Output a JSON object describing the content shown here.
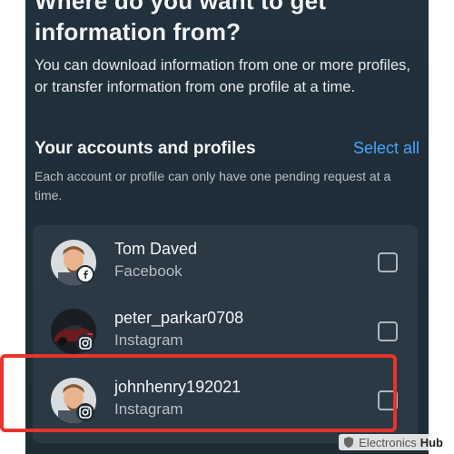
{
  "screen": {
    "heading_line1": "Where do you want to get",
    "heading_line2": "information from?",
    "description": "You can download information from one or more profiles, or transfer information from one profile at a time."
  },
  "section": {
    "title": "Your accounts and profiles",
    "select_all_label": "Select all",
    "subtitle": "Each account or profile can only have one pending request at a time."
  },
  "accounts": [
    {
      "name": "Tom Daved",
      "platform": "Facebook",
      "badge_icon": "facebook-icon",
      "checked": false
    },
    {
      "name": "peter_parkar0708",
      "platform": "Instagram",
      "badge_icon": "instagram-icon",
      "checked": false
    },
    {
      "name": "johnhenry192021",
      "platform": "Instagram",
      "badge_icon": "instagram-icon",
      "checked": false
    }
  ],
  "highlight_color": "#e8332e",
  "accent_color": "#4aa3ff",
  "watermark": {
    "text_1": "Electronics",
    "text_2": "Hub"
  }
}
